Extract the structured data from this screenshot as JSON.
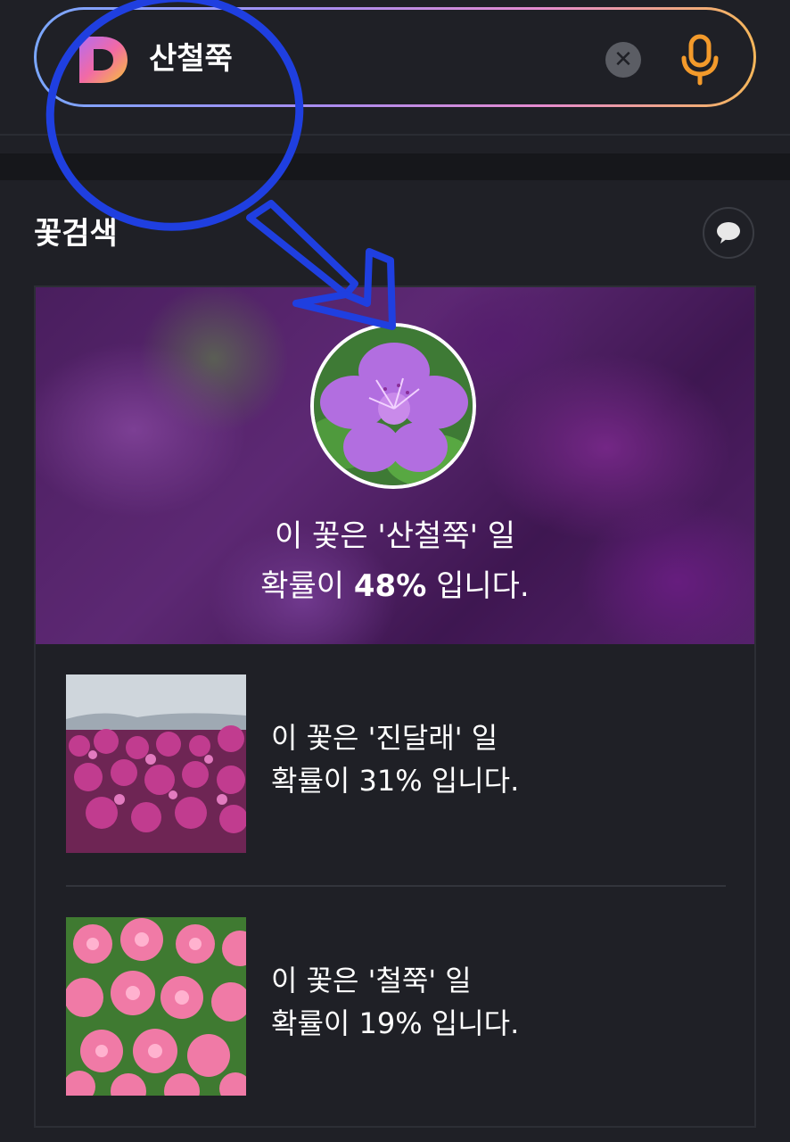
{
  "search": {
    "query": "산철쭉",
    "logo_letter": "D"
  },
  "section": {
    "title": "꽃검색"
  },
  "top_result": {
    "line1": "이 꽃은 '산철쭉' 일",
    "line2_prefix": "확률이 ",
    "percent": "48%",
    "line2_suffix": " 입니다."
  },
  "results": [
    {
      "line1": "이 꽃은 '진달래' 일",
      "line2": "확률이 31% 입니다."
    },
    {
      "line1": "이 꽃은 '철쭉' 일",
      "line2": "확률이 19% 입니다."
    }
  ],
  "colors": {
    "background": "#1f2026",
    "mic": "#f39a2b",
    "annotation": "#1f3fe0"
  },
  "icons": [
    "logo-d-icon",
    "clear-icon",
    "microphone-icon",
    "speech-bubble-icon"
  ]
}
